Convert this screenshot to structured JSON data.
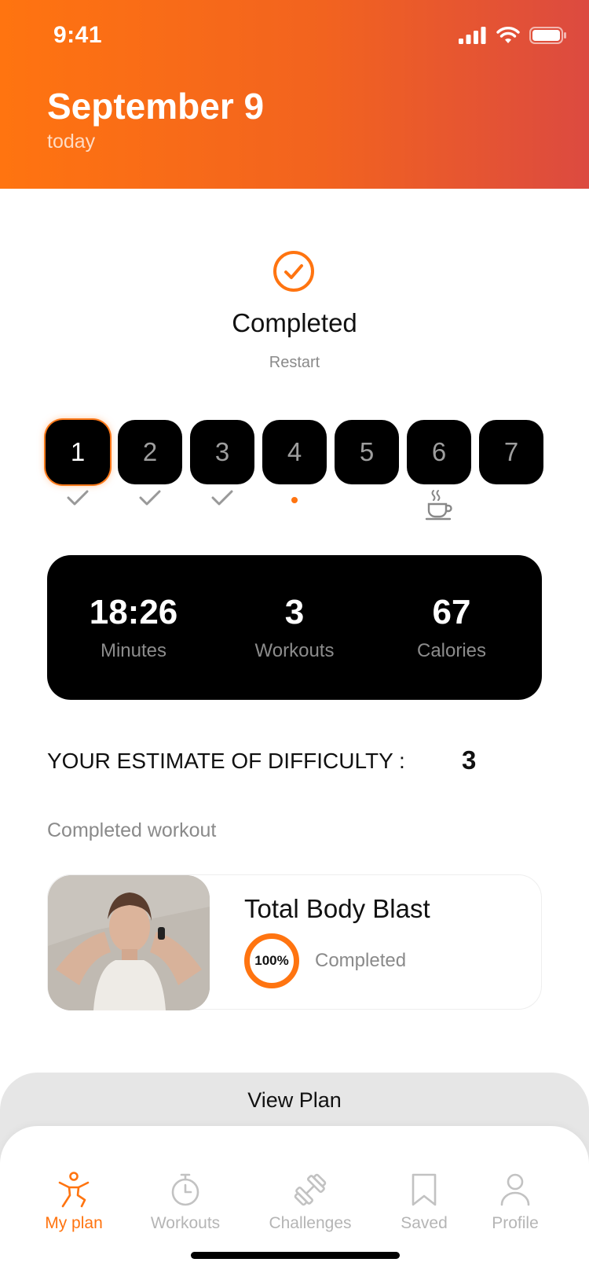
{
  "status_bar": {
    "time": "9:41"
  },
  "header": {
    "title": "September 9",
    "subtitle": "today"
  },
  "completion": {
    "title": "Completed",
    "restart_label": "Restart"
  },
  "days": [
    {
      "label": "1",
      "state": "done",
      "active": true
    },
    {
      "label": "2",
      "state": "done",
      "active": false
    },
    {
      "label": "3",
      "state": "done",
      "active": false
    },
    {
      "label": "4",
      "state": "current",
      "active": false
    },
    {
      "label": "5",
      "state": "none",
      "active": false
    },
    {
      "label": "6",
      "state": "rest",
      "active": false
    },
    {
      "label": "7",
      "state": "none",
      "active": false
    }
  ],
  "stats": [
    {
      "value": "18:26",
      "label": "Minutes"
    },
    {
      "value": "3",
      "label": "Workouts"
    },
    {
      "value": "67",
      "label": "Calories"
    }
  ],
  "difficulty": {
    "label": "YOUR ESTIMATE OF DIFFICULTY :",
    "value": "3"
  },
  "completed_section": {
    "label": "Completed workout"
  },
  "workout": {
    "title": "Total Body Blast",
    "progress": "100%",
    "progress_fraction": 1.0,
    "status": "Completed"
  },
  "sheet": {
    "title": "View Plan"
  },
  "tabs": [
    {
      "label": "My plan",
      "icon": "person-stretch-icon",
      "active": true
    },
    {
      "label": "Workouts",
      "icon": "stopwatch-icon",
      "active": false
    },
    {
      "label": "Challenges",
      "icon": "dumbbell-icon",
      "active": false
    },
    {
      "label": "Saved",
      "icon": "bookmark-icon",
      "active": false
    },
    {
      "label": "Profile",
      "icon": "profile-icon",
      "active": false
    }
  ],
  "colors": {
    "accent": "#ff7410",
    "header_end": "#dc4a40",
    "muted": "#8a8a8a"
  }
}
